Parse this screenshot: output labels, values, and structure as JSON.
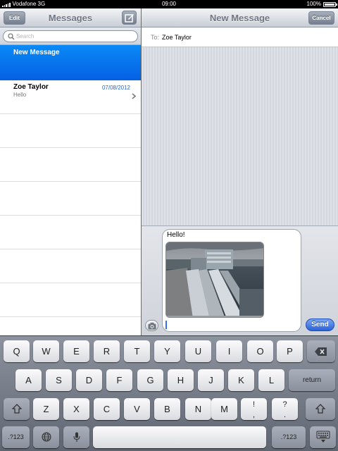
{
  "status_bar": {
    "carrier": "Vodafone 3G",
    "time": "09:00",
    "battery": "100%",
    "battery_level": 1.0
  },
  "sidebar": {
    "title": "Messages",
    "edit_label": "Edit",
    "search_placeholder": "Search",
    "new_message_label": "New Message",
    "conversations": [
      {
        "name": "Zoe Taylor",
        "date": "07/08/2012",
        "preview": "Hello"
      }
    ]
  },
  "compose": {
    "title": "New Message",
    "cancel_label": "Cancel",
    "to_label": "To:",
    "to_value": "Zoe Taylor",
    "message_text": "Hello!",
    "send_label": "Send"
  },
  "keyboard": {
    "row1": [
      "Q",
      "W",
      "E",
      "R",
      "T",
      "Y",
      "U",
      "I",
      "O",
      "P"
    ],
    "row2": [
      "A",
      "S",
      "D",
      "F",
      "G",
      "H",
      "J",
      "K",
      "L"
    ],
    "return_label": "return",
    "row3": [
      "Z",
      "X",
      "C",
      "V",
      "B",
      "N",
      "M"
    ],
    "row3_punct": [
      {
        "top": "!",
        "bottom": ","
      },
      {
        "top": "?",
        "bottom": "."
      }
    ],
    "numbers_label": ".?123"
  },
  "icons": [
    "signal-icon",
    "battery-icon",
    "compose-icon",
    "search-icon",
    "chevron-right-icon",
    "camera-icon",
    "backspace-icon",
    "shift-icon",
    "globe-icon",
    "microphone-icon",
    "keyboard-dismiss-icon"
  ]
}
